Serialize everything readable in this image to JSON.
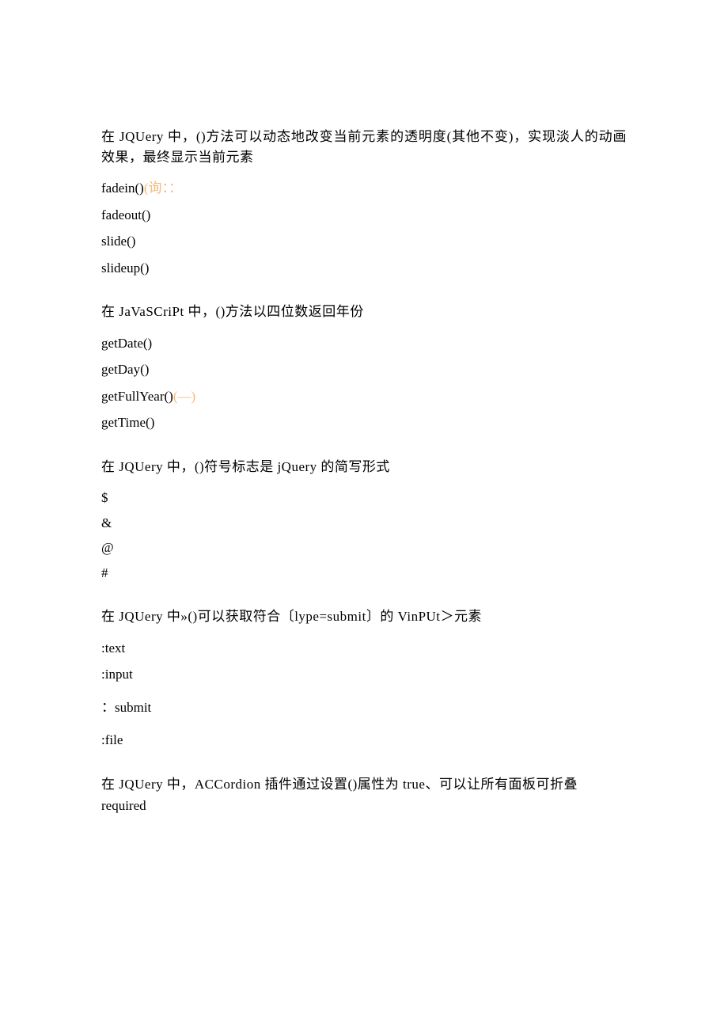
{
  "q1": {
    "prompt": "在 JQUery 中，()方法可以动态地改变当前元素的透明度(其他不变)，实现淡人的动画效果，最终显示当前元素",
    "a_main": "fadein()",
    "a_annot": "(询：：",
    "b": "fadeout()",
    "c": "slide()",
    "d": "slideup()"
  },
  "q2": {
    "prompt": "在 JaVaSCriPt 中，()方法以四位数返回年份",
    "a": "getDate()",
    "b": "getDay()",
    "c_main": "getFullYear()",
    "c_annot": "(—)",
    "d": "getTime()"
  },
  "q3": {
    "prompt": "在 JQUery 中，()符号标志是 jQuery 的简写形式",
    "a": "$",
    "b": "&",
    "c": "@",
    "d": "#"
  },
  "q4": {
    "prompt": "在 JQUery 中»()可以获取符合〔lype=submit〕的 VinPUt＞元素",
    "a": ":text",
    "b": ":input",
    "c": "：submit",
    "d": ":file"
  },
  "q5": {
    "prompt": "在 JQUery 中，ACCordion 插件通过设置()属性为 true、可以让所有面板可折叠",
    "a": "required"
  }
}
